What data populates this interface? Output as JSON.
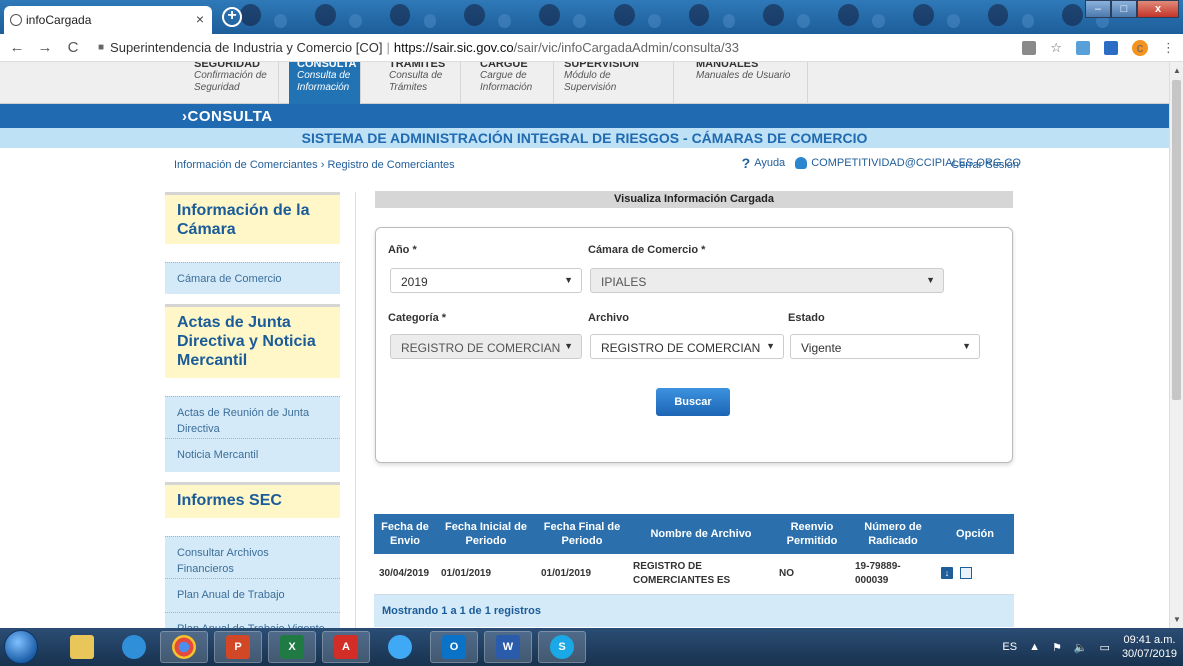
{
  "browser": {
    "tab_title": "infoCargada",
    "tab_close": "×",
    "new_tab": "+",
    "nav_back": "←",
    "nav_forward": "→",
    "nav_reload": "C",
    "url_site": "Superintendencia de Industria y Comercio [CO]",
    "url_sep": "|",
    "url_host": "https://sair.sic.gov.co",
    "url_path": "/sair/vic/infoCargadaAdmin/consulta/33",
    "star": "☆",
    "profile_letter": "c",
    "more": "⋮"
  },
  "menu": [
    {
      "title": "SEGURIDAD",
      "sub1": "Confirmación de",
      "sub2": "Seguridad",
      "active": false
    },
    {
      "title": "CONSULTA",
      "sub1": "Consulta de",
      "sub2": "Información",
      "active": true
    },
    {
      "title": "TRAMITES",
      "sub1": "Consulta de",
      "sub2": "Trámites",
      "active": false
    },
    {
      "title": "CARGUE",
      "sub1": "Cargue de",
      "sub2": "Información",
      "active": false
    },
    {
      "title": "SUPERVISION",
      "sub1": "Módulo de Supervisión",
      "sub2": "",
      "active": false
    },
    {
      "title": "MANUALES",
      "sub1": "Manuales de Usuario",
      "sub2": "",
      "active": false
    }
  ],
  "section_label": "›CONSULTA",
  "system_title": "SISTEMA DE ADMINISTRACIÓN INTEGRAL DE RIESGOS - CÁMARAS DE COMERCIO",
  "breadcrumb": {
    "part1": "Información de Comerciantes",
    "sep": "›",
    "part2": "Registro de Comerciantes"
  },
  "top_links": {
    "help_mark": "?",
    "help": "Ayuda",
    "user_email": "COMPETITIVIDAD@CCIPIALES.ORG.CO",
    "logout": "Cerrar Sesión"
  },
  "sidebar": {
    "sections": [
      {
        "title": "Información de la Cámara",
        "links": [
          "Cámara de Comercio"
        ]
      },
      {
        "title": "Actas de Junta Directiva y Noticia Mercantil",
        "links": [
          "Actas de Reunión de Junta Directiva",
          "Noticia Mercantil"
        ]
      },
      {
        "title": "Informes SEC",
        "links": [
          "Consultar Archivos Financieros",
          "Plan Anual de Trabajo",
          "Plan Anual de Trabajo Vigente"
        ]
      }
    ]
  },
  "panel_title": "Visualiza Información Cargada",
  "form": {
    "year_label": "Año *",
    "year_value": "2019",
    "chamber_label": "Cámara de Comercio *",
    "chamber_value": "IPIALES",
    "category_label": "Categoría *",
    "category_value": "REGISTRO DE COMERCIAN",
    "file_label": "Archivo",
    "file_value": "REGISTRO DE COMERCIAN",
    "state_label": "Estado",
    "state_value": "Vigente",
    "search_button": "Buscar",
    "caret": "▼"
  },
  "table": {
    "headers": [
      "Fecha de Envio",
      "Fecha Inicial de Periodo",
      "Fecha Final de Periodo",
      "Nombre de Archivo",
      "Reenvio Permitido",
      "Número de Radicado",
      "Opción"
    ],
    "rows": [
      [
        "30/04/2019",
        "01/01/2019",
        "01/01/2019",
        "REGISTRO DE COMERCIANTES ES",
        "NO",
        "19-79889-000039"
      ]
    ],
    "footer": "Mostrando 1 a 1 de 1 registros"
  },
  "taskbar": {
    "apps": [
      "folder",
      "ie",
      "chrome",
      "powerpoint",
      "excel",
      "acrobat",
      "app",
      "outlook",
      "word",
      "skype"
    ],
    "lang": "ES",
    "time": "09:41 a.m.",
    "date": "30/07/2019"
  }
}
